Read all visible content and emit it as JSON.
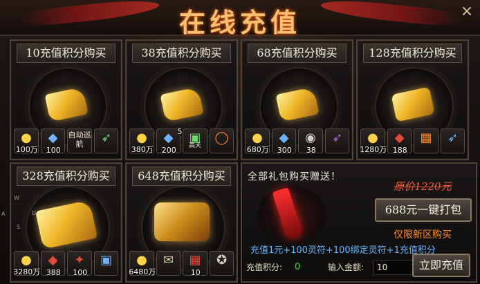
{
  "title": "在线充值",
  "close_label": "×",
  "packages": [
    {
      "title": "10充值积分购买",
      "items": [
        {
          "icon": "gold-coins-icon",
          "glyph": "●",
          "count": "100万"
        },
        {
          "icon": "blue-gem-icon",
          "glyph": "◆",
          "count": "100"
        },
        {
          "icon": "auto-cruise-icon",
          "glyph": "",
          "label": "自动巡航",
          "count": ""
        },
        {
          "icon": "green-arrow-icon",
          "glyph": "➶",
          "count": ""
        }
      ]
    },
    {
      "title": "38充值积分购买",
      "items": [
        {
          "icon": "gold-coins-icon",
          "glyph": "●",
          "count": "380万"
        },
        {
          "icon": "blue-gem-icon",
          "glyph": "◆",
          "count": "200"
        },
        {
          "icon": "green-book-icon",
          "glyph": "▣",
          "count": "5",
          "label": "高天"
        },
        {
          "icon": "fire-ring-icon",
          "glyph": "◯",
          "count": ""
        }
      ]
    },
    {
      "title": "68充值积分购买",
      "items": [
        {
          "icon": "gold-coins-icon",
          "glyph": "●",
          "count": "680万"
        },
        {
          "icon": "blue-gem-icon",
          "glyph": "◆",
          "count": "300"
        },
        {
          "icon": "silver-orb-icon",
          "glyph": "◉",
          "count": "38"
        },
        {
          "icon": "purple-blade-icon",
          "glyph": "➶",
          "count": ""
        }
      ]
    },
    {
      "title": "128充值积分购买",
      "items": [
        {
          "icon": "gold-coins-icon",
          "glyph": "●",
          "count": "1280万"
        },
        {
          "icon": "red-crystal-icon",
          "glyph": "◆",
          "count": "188"
        },
        {
          "icon": "treasure-box-icon",
          "glyph": "▦",
          "count": ""
        },
        {
          "icon": "blue-blade-icon",
          "glyph": "➶",
          "count": ""
        }
      ]
    },
    {
      "title": "328充值积分购买",
      "items": [
        {
          "icon": "gold-coins-icon",
          "glyph": "●",
          "count": "3280万"
        },
        {
          "icon": "red-crystal-icon",
          "glyph": "◆",
          "count": "388"
        },
        {
          "icon": "red-scroll-icon",
          "glyph": "✦",
          "count": "100"
        },
        {
          "icon": "blue-book-icon",
          "glyph": "▣",
          "count": ""
        }
      ]
    },
    {
      "title": "648充值积分购买",
      "items": [
        {
          "icon": "gold-coins-icon",
          "glyph": "●",
          "count": "6480万"
        },
        {
          "icon": "scroll-icon",
          "glyph": "✉",
          "count": ""
        },
        {
          "icon": "red-chest-icon",
          "glyph": "▦",
          "count": "10"
        },
        {
          "icon": "armor-icon",
          "glyph": "✪",
          "count": ""
        }
      ]
    }
  ],
  "gift": {
    "title": "全部礼包购买赠送！",
    "original_price": "原价1220元",
    "buy_label": "688元一键打包",
    "new_server_only": "仅限新区购买",
    "description": "充值1元+100灵符+100绑定灵符+1充值积分",
    "points_label": "充值积分:",
    "points_value": "0",
    "amount_label": "输入金额:",
    "amount_value": "10",
    "recharge_label": "立即充值"
  },
  "side_letters": [
    "W",
    "A",
    "D",
    "S"
  ]
}
